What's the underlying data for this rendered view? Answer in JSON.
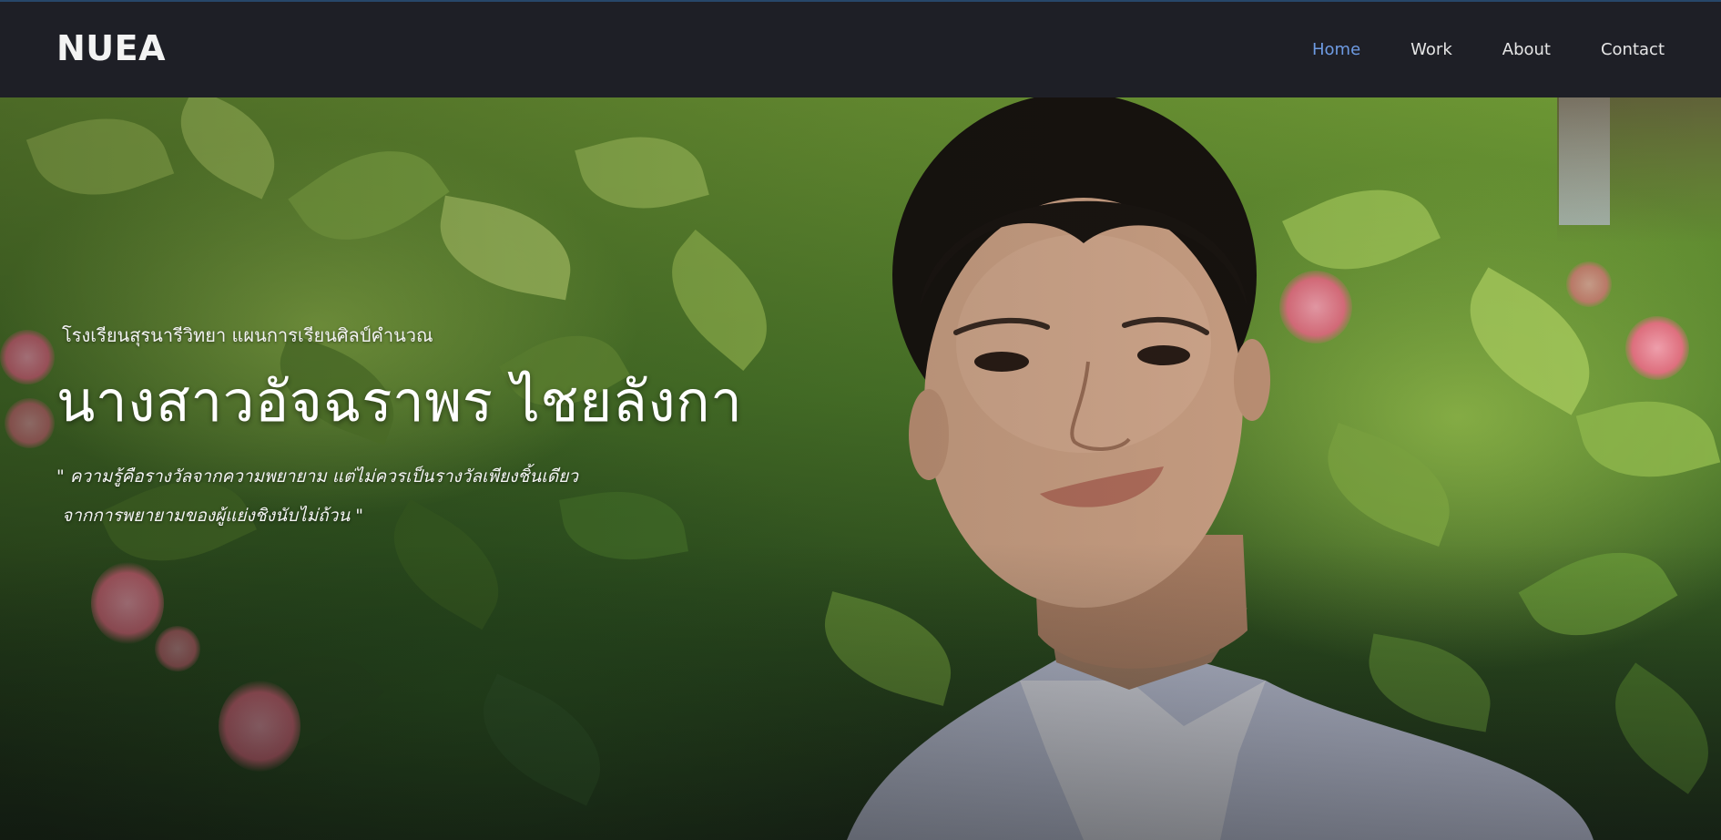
{
  "header": {
    "brand": "NUEA",
    "nav": [
      {
        "label": "Home",
        "active": true
      },
      {
        "label": "Work",
        "active": false
      },
      {
        "label": "About",
        "active": false
      },
      {
        "label": "Contact",
        "active": false
      }
    ]
  },
  "hero": {
    "school": "โรงเรียนสุรนารีวิทยา แผนการเรียนศิลป์คำนวณ",
    "name": "นางสาวอัจฉราพร ไชยลังกา",
    "quote_line1": "\" ความรู้คือรางวัลจากความพยายาม แต่ไม่ควรเป็นรางวัลเพียงชิ้นเดียว",
    "quote_line2": "จากการพยายามของผู้แย่งชิงนับไม่ถ้วน \""
  },
  "colors": {
    "header_bg": "#1e1f26",
    "accent": "#6e9be3",
    "nav_text": "#e6e6e6"
  }
}
